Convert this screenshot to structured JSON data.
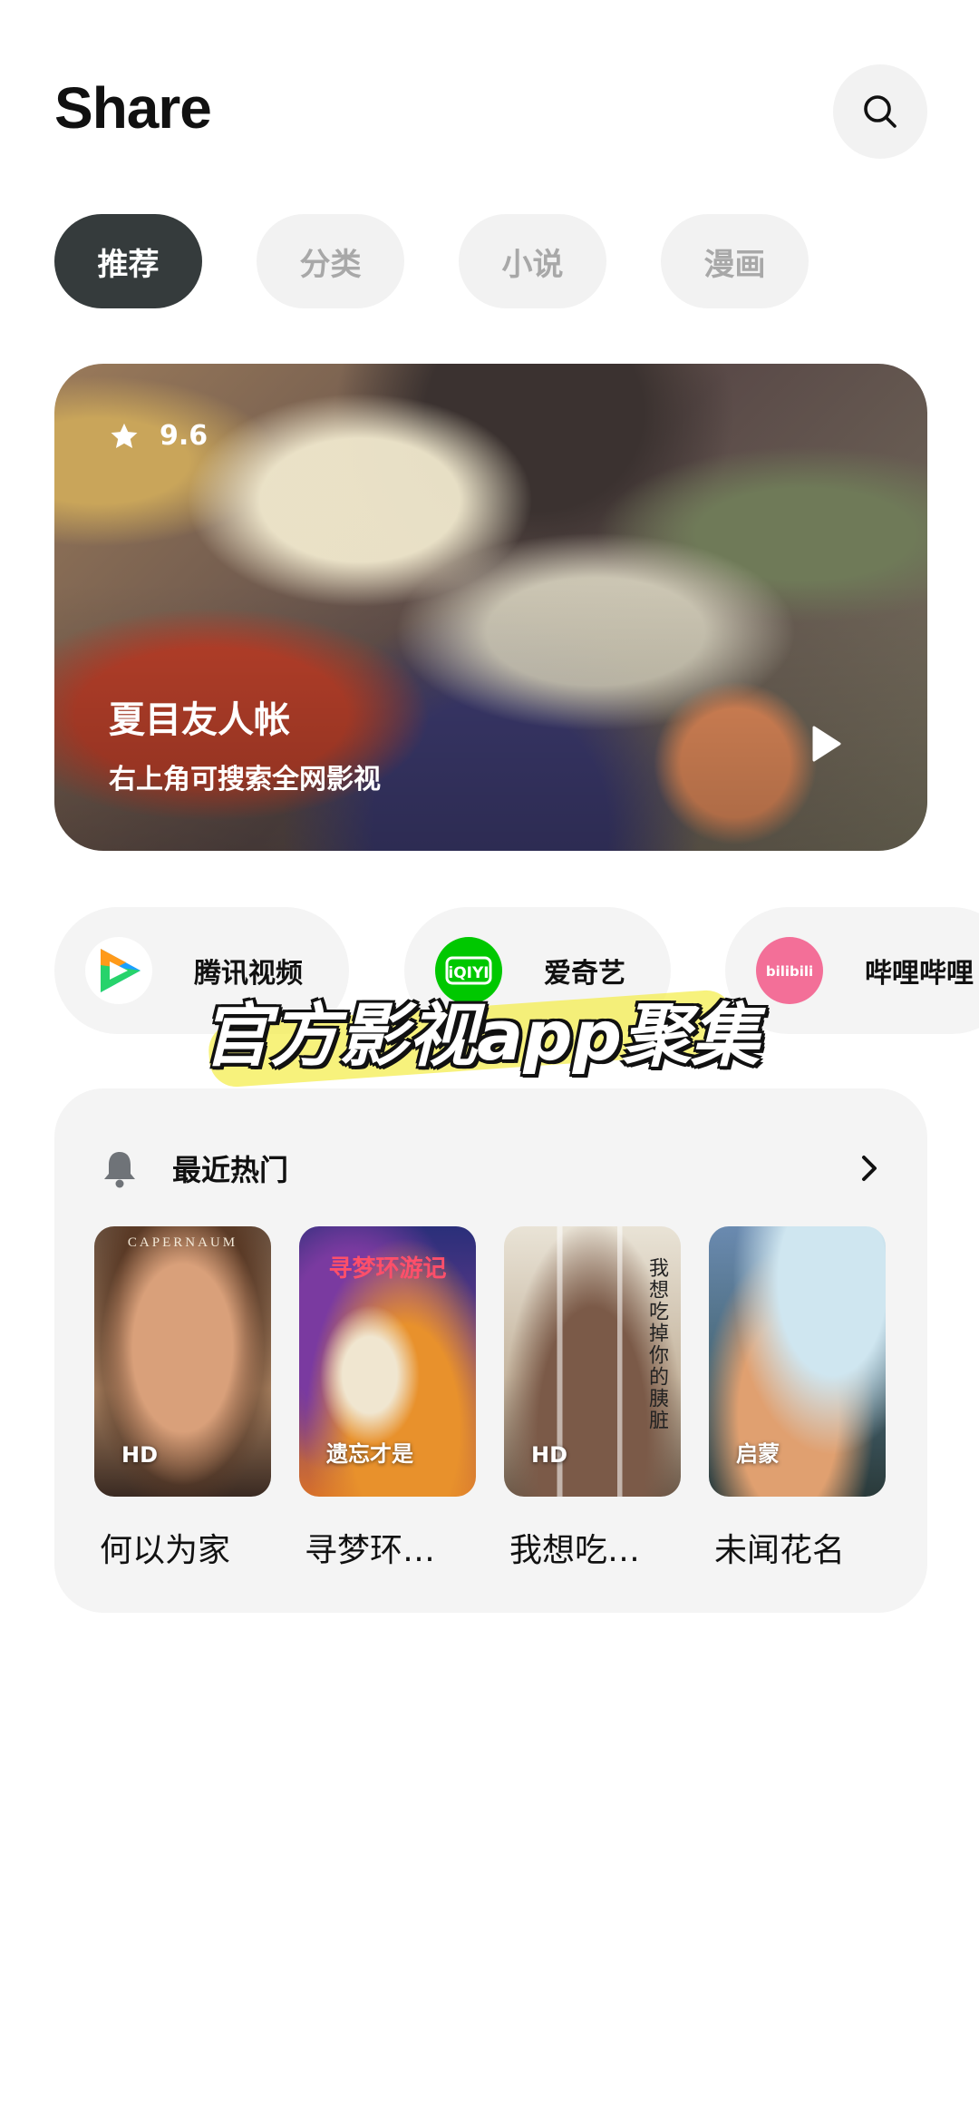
{
  "header": {
    "app_title": "Share"
  },
  "tabs": [
    {
      "label": "推荐",
      "active": true
    },
    {
      "label": "分类",
      "active": false
    },
    {
      "label": "小说",
      "active": false
    },
    {
      "label": "漫画",
      "active": false
    }
  ],
  "banner": {
    "rating": "9.6",
    "title": "夏目友人帐",
    "subtitle": "右上角可搜索全网影视"
  },
  "platforms": [
    {
      "label": "腾讯视频",
      "icon": "tencent-video-icon",
      "color": "#ffffff"
    },
    {
      "label": "爱奇艺",
      "icon": "iqiyi-icon",
      "color": "#00c800"
    },
    {
      "label": "哔哩哔哩",
      "icon": "bilibili-icon",
      "color": "#f36f98"
    }
  ],
  "overlay_caption": "官方影视app聚集",
  "hot": {
    "title": "最近热门",
    "items": [
      {
        "title": "何以为家",
        "badge": "HD",
        "poster_text": "CAPERNAUM"
      },
      {
        "title": "寻梦环…",
        "badge": "遗忘才是",
        "poster_text": "寻梦环游记"
      },
      {
        "title": "我想吃…",
        "badge": "HD",
        "poster_text": "我想吃掉你的胰脏"
      },
      {
        "title": "未闻花名",
        "badge": "启蒙",
        "poster_text": ""
      }
    ]
  },
  "colors": {
    "active_tab": "#353b3c",
    "chip_bg": "#f2f2f2",
    "card_bg": "#f4f4f4"
  }
}
